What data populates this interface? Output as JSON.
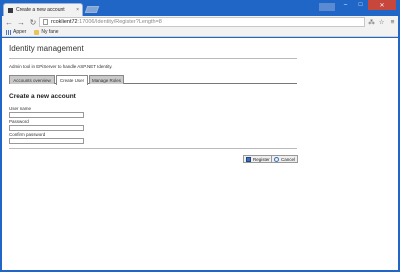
{
  "browser": {
    "tab": {
      "title": "Create a new account",
      "close": "×"
    },
    "window_controls": {
      "minimize": "–",
      "maximize": "□",
      "close": "✕"
    },
    "nav": {
      "back": "←",
      "forward": "→",
      "reload": "↻"
    },
    "address": {
      "host": "rcoklient72",
      "path": ":17006/Identity/Register?Length=8"
    },
    "toolbar_icons": {
      "translate": "⁂",
      "star": "☆",
      "menu": "≡"
    },
    "bookmarks": [
      {
        "label": "Apper",
        "icon": "apps-icon"
      },
      {
        "label": "Ny fane",
        "icon": "folder-icon"
      }
    ]
  },
  "page": {
    "title": "Identity management",
    "description": "Admin tool in EPiServer to handle ASP.NET Identity.",
    "tabs": [
      {
        "label": "Accounts overview",
        "active": false
      },
      {
        "label": "Create User",
        "active": true
      },
      {
        "label": "Manage Roles",
        "active": false
      }
    ],
    "section_title": "Create a new account",
    "fields": [
      {
        "label": "User name",
        "value": ""
      },
      {
        "label": "Password",
        "value": ""
      },
      {
        "label": "Confirm password",
        "value": ""
      }
    ],
    "buttons": {
      "register": "Register",
      "cancel": "Cancel"
    }
  },
  "colors": {
    "window_frame": "#1f66c6",
    "close_button": "#c7473c",
    "tab_inactive": "#c9c9c9"
  }
}
